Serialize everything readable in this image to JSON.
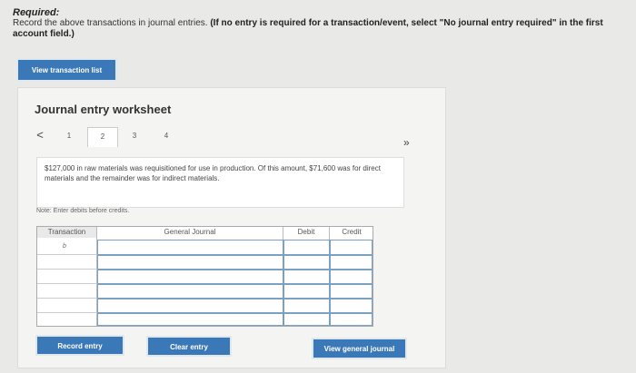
{
  "required": {
    "title": "Required:",
    "text_normal": "Record the above transactions in journal entries. ",
    "text_bold": "(If no entry is required for a transaction/event, select \"No journal entry required\" in the first account field.)"
  },
  "view_transaction_list": "View transaction list",
  "worksheet": {
    "title": "Journal entry worksheet",
    "prev_glyph": "<",
    "next_glyph": "»",
    "tabs": [
      "1",
      "2",
      "3",
      "4"
    ],
    "description": "$127,000 in raw materials was requisitioned for use in production. Of this amount, $71,600 was for direct materials and the remainder was for indirect materials.",
    "note": "Note: Enter debits before credits."
  },
  "table": {
    "headers": {
      "transaction": "Transaction",
      "general_journal": "General Journal",
      "debit": "Debit",
      "credit": "Credit"
    },
    "transaction_value": "b"
  },
  "buttons": {
    "record_entry": "Record entry",
    "clear_entry": "Clear entry",
    "view_general_journal": "View general journal"
  },
  "colors": {
    "button_blue": "#3b78b8",
    "input_border": "#7aa0c4"
  }
}
